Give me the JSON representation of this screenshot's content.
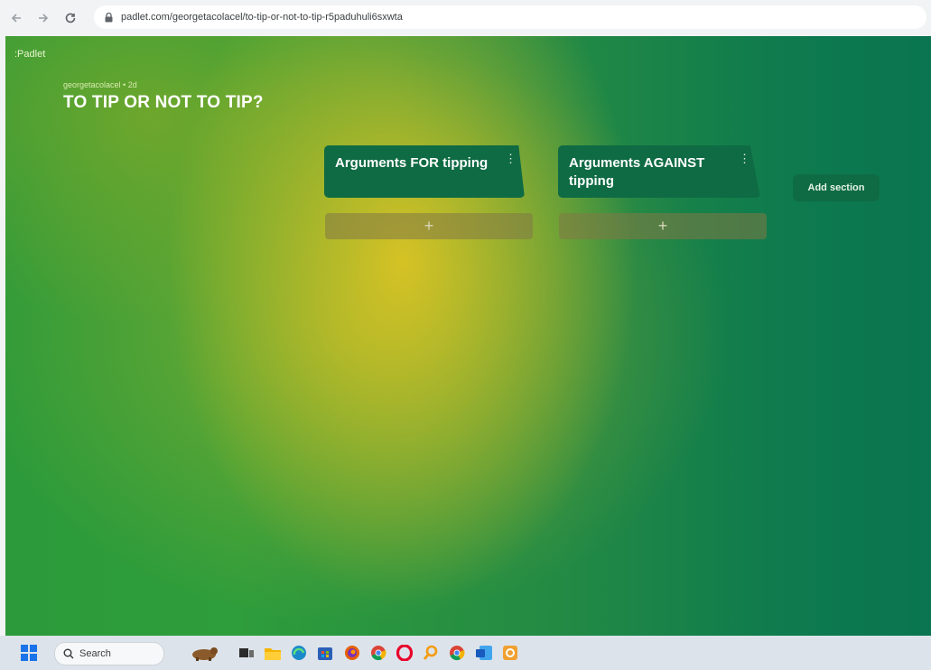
{
  "browser": {
    "url": "padlet.com/georgetacolacel/to-tip-or-not-to-tip-r5paduhuli6sxwta"
  },
  "padlet": {
    "logo": ":Padlet",
    "author": "georgetacolacel • 2d",
    "title": "TO TIP OR NOT TO TIP?",
    "sections": [
      {
        "label": "Arguments FOR tipping",
        "add_label": "+"
      },
      {
        "label": "Arguments AGAINST tipping",
        "add_label": "+"
      }
    ],
    "add_section_label": "Add section"
  },
  "taskbar": {
    "search_label": "Search",
    "apps": [
      "windows-start",
      "bull-widget",
      "task-view",
      "file-explorer",
      "edge",
      "store",
      "firefox",
      "chrome",
      "opera",
      "search-app",
      "chrome-active",
      "word",
      "app-orange"
    ]
  },
  "colors": {
    "section_header": "#0f6b44",
    "add_section": "#0e6b44",
    "canvas_green": "#2e9d3b",
    "canvas_yellow": "#dcc424"
  }
}
